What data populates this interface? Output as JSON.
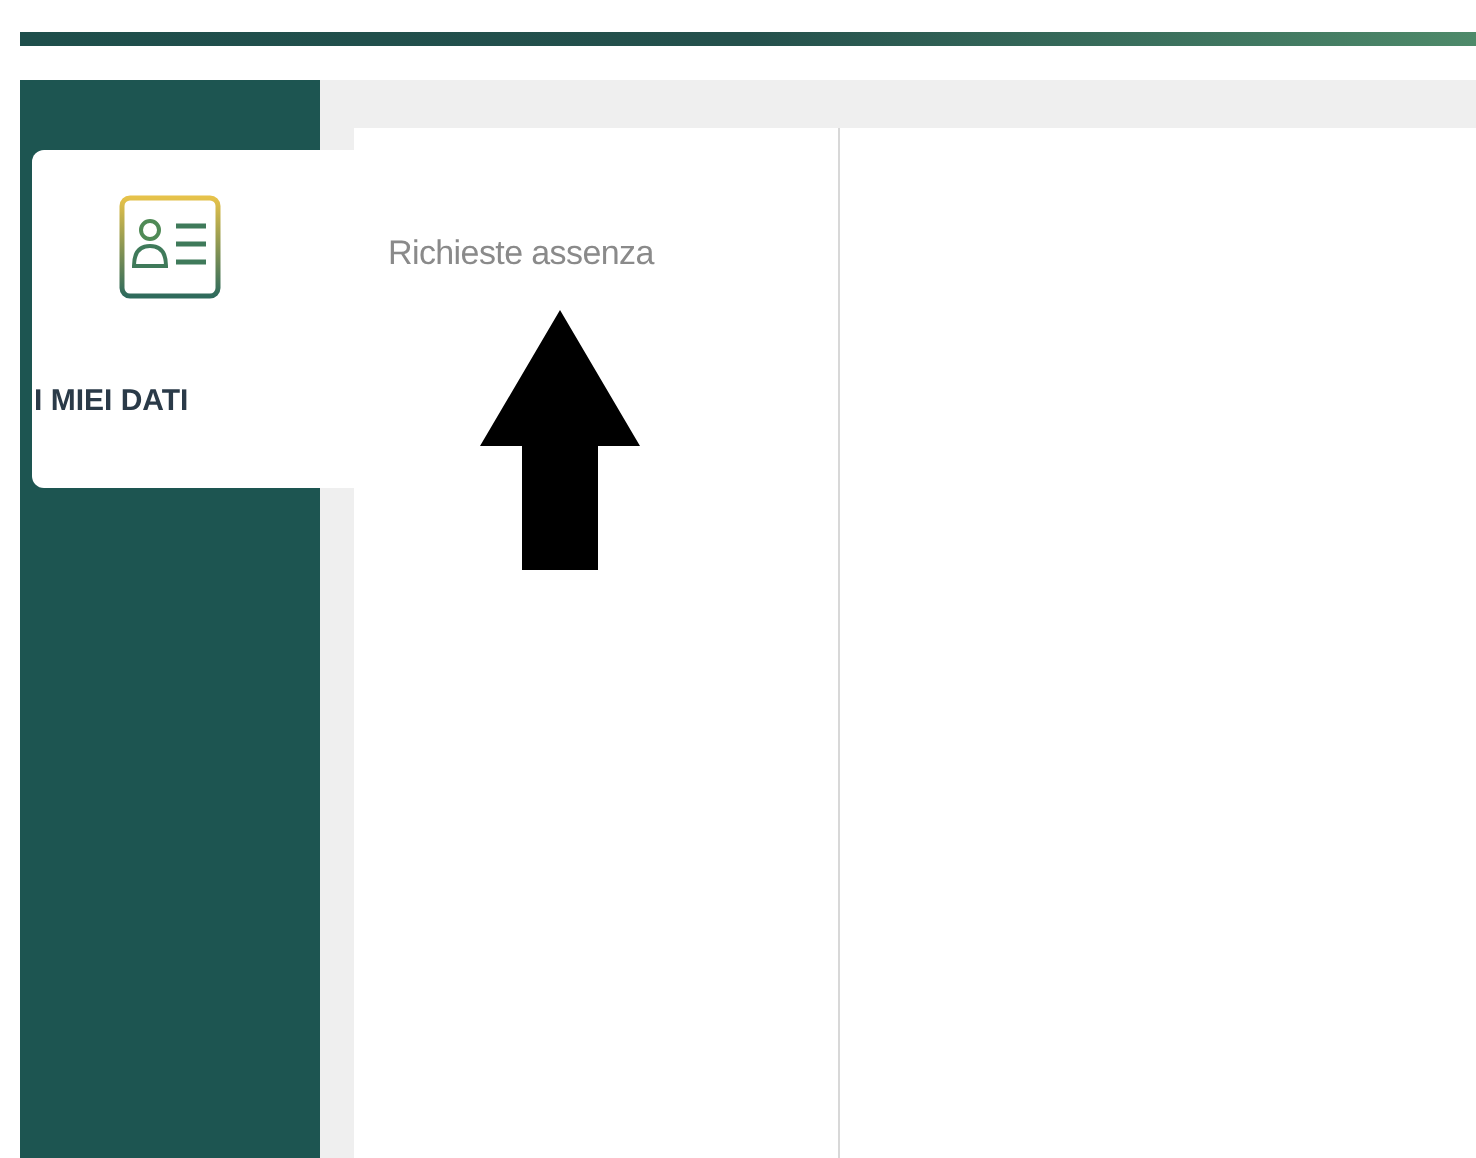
{
  "sidebar": {
    "items": [
      {
        "label": "I MIEI DATI",
        "selected": true
      }
    ]
  },
  "submenu": {
    "items": [
      {
        "label": "Richieste assenza"
      }
    ]
  },
  "annotation": {
    "kind": "arrow"
  }
}
